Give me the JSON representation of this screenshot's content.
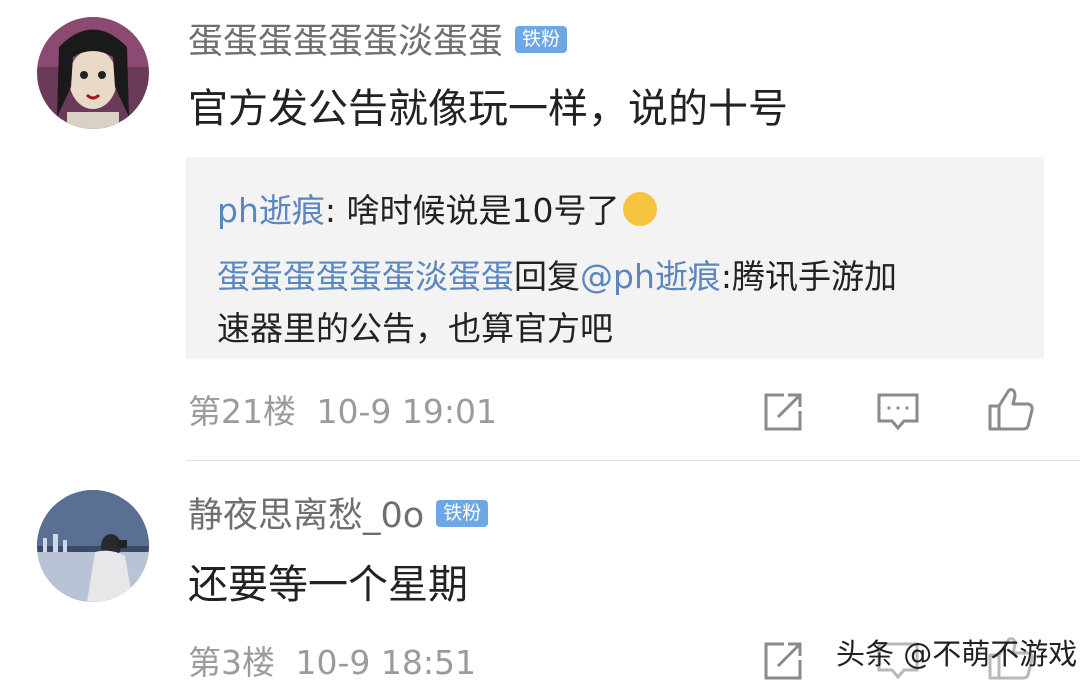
{
  "comments": [
    {
      "username": "蛋蛋蛋蛋蛋蛋淡蛋蛋",
      "badge": "铁粉",
      "content": "官方发公告就像玩一样，说的十号",
      "replies": [
        {
          "author": "ph逝痕",
          "sep": ":",
          "text": " 啥时候说是10号了",
          "emoji": "shush-emoji"
        },
        {
          "author": "蛋蛋蛋蛋蛋蛋淡蛋蛋",
          "reply_word": "回复",
          "mention": "@ph逝痕",
          "text_line1": ":腾讯手游加",
          "text_line2": "速器里的公告，也算官方吧"
        }
      ],
      "floor": "第21楼",
      "time": "10-9 19:01"
    },
    {
      "username": "静夜思离愁_0o",
      "badge": "铁粉",
      "content": "还要等一个星期",
      "floor": "第3楼",
      "time": "10-9 18:51"
    }
  ],
  "icons": [
    "share-icon",
    "comment-icon",
    "like-icon"
  ],
  "watermark": "头条 @不萌不游戏",
  "colors": {
    "badge": "#6fa7e6",
    "link": "#5b87c0",
    "meta": "#9b9b9b",
    "quote_bg": "#f3f3f3"
  }
}
